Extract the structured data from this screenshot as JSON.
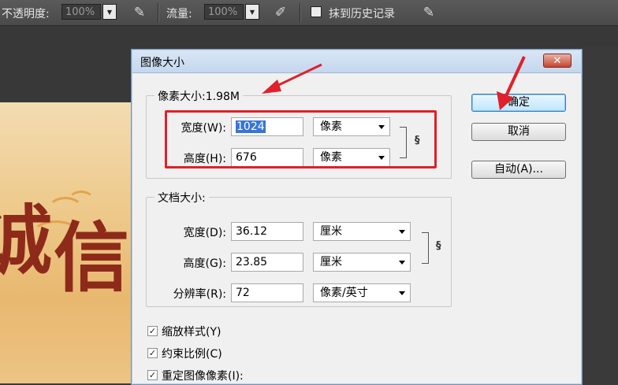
{
  "options_bar": {
    "opacity_label": "不透明度:",
    "opacity_value": "100%",
    "flow_label": "流量:",
    "flow_value": "100%",
    "erase_history_label": "抹到历史记录"
  },
  "dialog": {
    "title": "图像大小",
    "close_symbol": "✕",
    "pixel_dimensions": {
      "legend": "像素大小:1.98M",
      "width_label": "宽度(W):",
      "width_value": "1024",
      "width_unit": "像素",
      "height_label": "高度(H):",
      "height_value": "676",
      "height_unit": "像素"
    },
    "document_size": {
      "legend": "文档大小:",
      "width_label": "宽度(D):",
      "width_value": "36.12",
      "width_unit": "厘米",
      "height_label": "高度(G):",
      "height_value": "23.85",
      "height_unit": "厘米",
      "resolution_label": "分辨率(R):",
      "resolution_value": "72",
      "resolution_unit": "像素/英寸"
    },
    "buttons": {
      "ok": "确定",
      "cancel": "取消",
      "auto": "自动(A)..."
    },
    "checkboxes": [
      {
        "label": "缩放样式(Y)",
        "checked": true
      },
      {
        "label": "约束比例(C)",
        "checked": true
      },
      {
        "label": "重定图像像素(I):",
        "checked": true
      }
    ]
  },
  "background_image": {
    "big_chars": [
      "诚",
      "信"
    ]
  },
  "colors": {
    "annotation_red": "#e0202a",
    "selection_blue": "#3875d7"
  }
}
